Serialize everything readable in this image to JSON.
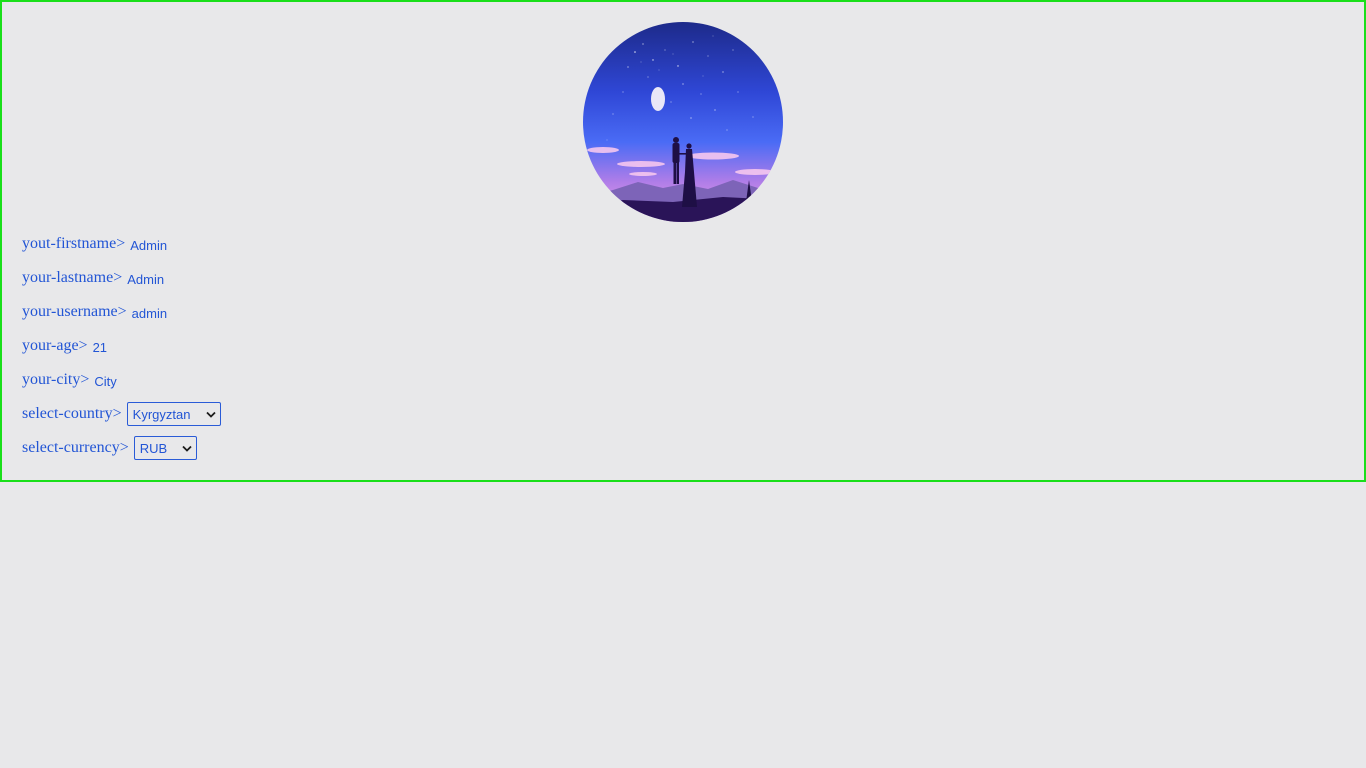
{
  "avatar": {
    "icon": "night-sky-couple-avatar"
  },
  "fields": {
    "firstname": {
      "label": "yout-firstname>",
      "value": "Admin"
    },
    "lastname": {
      "label": "your-lastname>",
      "value": "Admin"
    },
    "username": {
      "label": "your-username>",
      "value": "admin"
    },
    "age": {
      "label": "your-age>",
      "value": "21"
    },
    "city": {
      "label": "your-city>",
      "value": "City"
    }
  },
  "selects": {
    "country": {
      "label": "select-country>",
      "selected": "Kyrgyztan"
    },
    "currency": {
      "label": "select-currency>",
      "selected": "RUB"
    }
  },
  "colors": {
    "text": "#2255d5",
    "border": "#1adf1a",
    "background": "#e8e8ea"
  }
}
